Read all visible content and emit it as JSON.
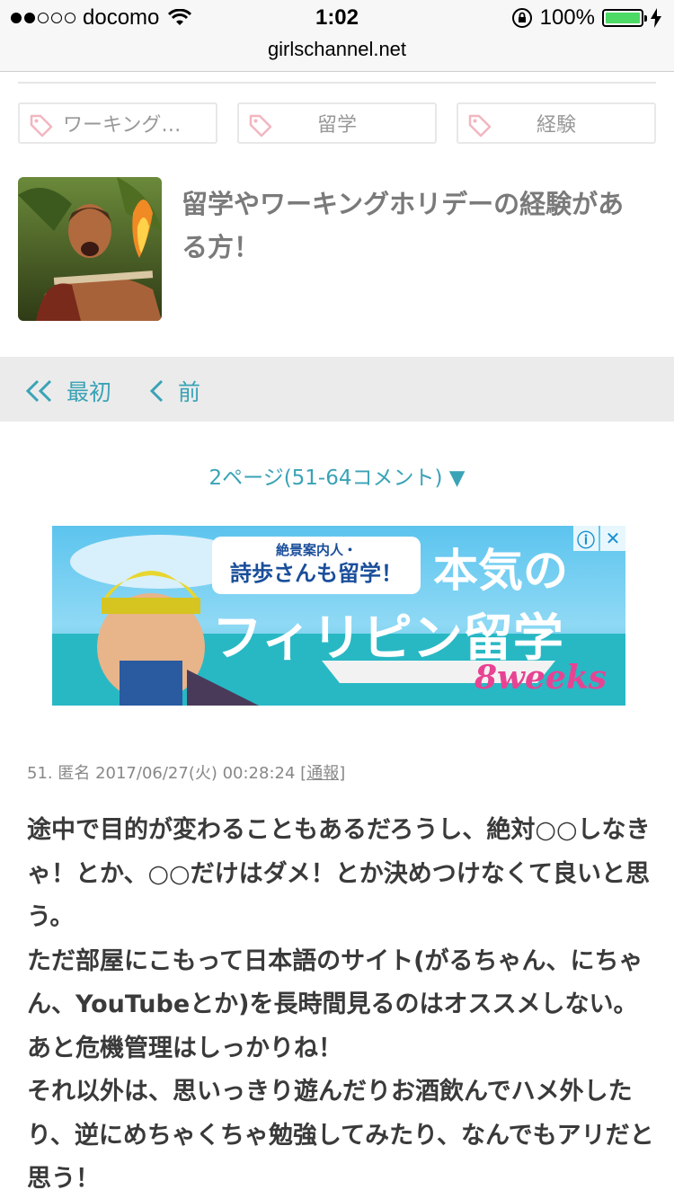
{
  "status_bar": {
    "carrier": "docomo",
    "time": "1:02",
    "battery_pct": "100%",
    "battery_level": 1.0
  },
  "browser": {
    "url": "girlschannel.net"
  },
  "tags": [
    {
      "label": "ワーキング…",
      "icon": "tag-icon"
    },
    {
      "label": "留学",
      "icon": "tag-icon"
    },
    {
      "label": "経験",
      "icon": "tag-icon"
    }
  ],
  "article": {
    "title": "留学やワーキングホリデーの経験がある方！"
  },
  "pager": {
    "first_label": "最初",
    "prev_label": "前"
  },
  "page_label": "2ページ(51-64コメント) ▼",
  "ad": {
    "bubble_line1": "絶景案内人・",
    "bubble_line2": "詩歩さんも留学！",
    "headline1": "本気の",
    "headline2": "フィリピン留学",
    "brand": "8weeks",
    "info_icon": "info-icon",
    "close_icon": "close-icon"
  },
  "comment": {
    "meta": "51. 匿名 2017/06/27(火) 00:28:24",
    "report_label": "[通報]",
    "lines": [
      "途中で目的が変わることもあるだろうし、絶対○○しなきゃ！とか、○○だけはダメ！とか決めつけなくて良いと思う。",
      "ただ部屋にこもって日本語のサイト(がるちゃん、にちゃん、YouTubeとか)を長時間見るのはオススメしない。あと危機管理はしっかりね！",
      "それ以外は、思いっきり遊んだりお酒飲んでハメ外したり、逆にめちゃくちゃ勉強してみたり、なんでもアリだと思う！"
    ]
  },
  "colors": {
    "accent": "#3aa3b6",
    "title_gray": "#7a7a7a",
    "battery_green": "#4cd964"
  }
}
